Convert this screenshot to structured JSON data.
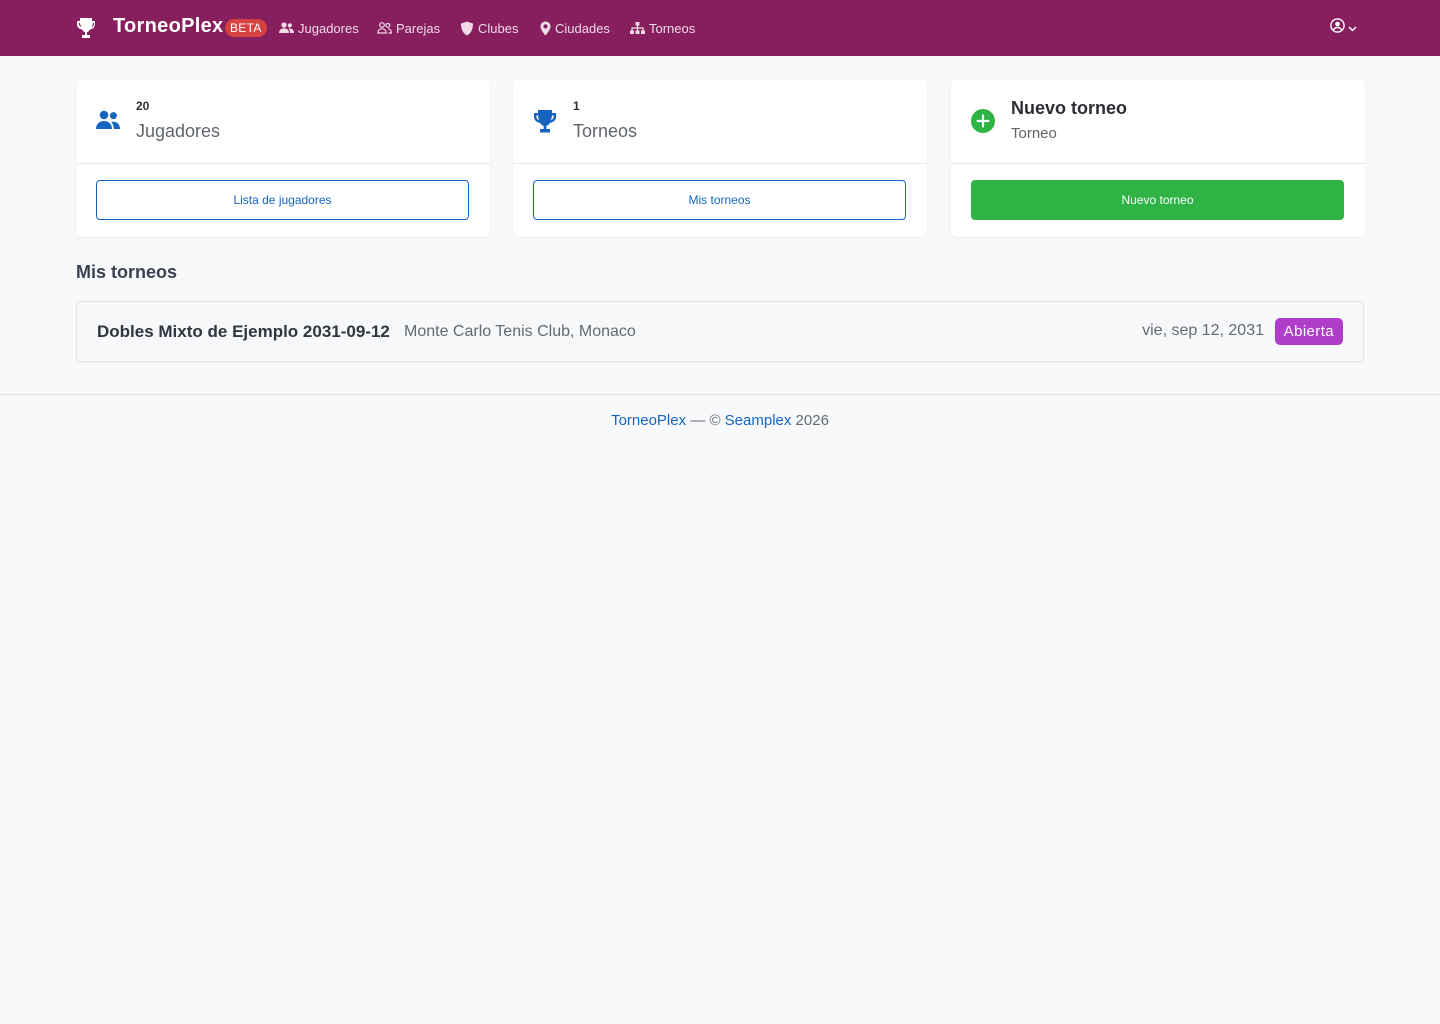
{
  "navbar": {
    "brand": "TorneoPlex",
    "beta": "BETA",
    "items": [
      {
        "label": "Jugadores",
        "icon": "users-icon"
      },
      {
        "label": "Parejas",
        "icon": "user-pair-icon"
      },
      {
        "label": "Clubes",
        "icon": "shield-icon"
      },
      {
        "label": "Ciudades",
        "icon": "map-pin-icon"
      },
      {
        "label": "Torneos",
        "icon": "sitemap-icon"
      }
    ],
    "user_icon": "user-circle-icon"
  },
  "cards": {
    "players": {
      "count": "20",
      "label": "Jugadores",
      "button": "Lista de jugadores",
      "icon": "users-icon"
    },
    "tournaments": {
      "count": "1",
      "label": "Torneos",
      "button": "Mis torneos",
      "icon": "trophy-icon"
    },
    "new": {
      "title": "Nuevo torneo",
      "subtitle": "Torneo",
      "button": "Nuevo torneo",
      "icon": "plus-circle-icon"
    }
  },
  "section": {
    "title": "Mis torneos"
  },
  "tournaments": [
    {
      "name": "Dobles Mixto de Ejemplo 2031-09-12",
      "club": "Monte Carlo Tenis Club, Monaco",
      "date": "vie, sep 12, 2031",
      "status": "Abierta"
    }
  ],
  "footer": {
    "brand_link": "TorneoPlex",
    "separator": " — © ",
    "company_link": "Seamplex",
    "year": " 2026"
  },
  "colors": {
    "navbar": "#871f5e",
    "primary": "#1565c0",
    "success": "#2fb344",
    "beta": "#d64141",
    "status": "#ae3ec9"
  }
}
